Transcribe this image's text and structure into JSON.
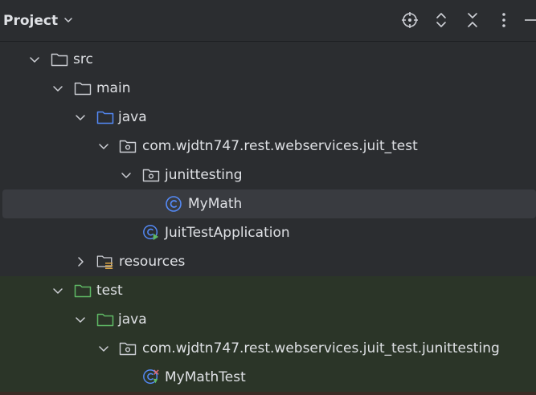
{
  "header": {
    "title": "Project",
    "icons": [
      "chevron-down-icon",
      "locate-icon",
      "expand-all-icon",
      "collapse-all-icon",
      "more-vert-icon",
      "minimize-icon"
    ]
  },
  "colors": {
    "background": "#2b2d30",
    "selected_row": "#393b40",
    "test_area": "#2b3528",
    "blue_folder": "#548af7",
    "green_folder": "#5fb865",
    "class_icon": "#548af7"
  },
  "tree": [
    {
      "label": "src",
      "expanded": true,
      "icon": "folder-icon"
    },
    {
      "label": "main",
      "expanded": true,
      "icon": "folder-icon"
    },
    {
      "label": "java",
      "expanded": true,
      "icon": "source-folder-icon"
    },
    {
      "label": "com.wjdtn747.rest.webservices.juit_test",
      "expanded": true,
      "icon": "package-icon"
    },
    {
      "label": "junittesting",
      "expanded": true,
      "icon": "package-icon"
    },
    {
      "label": "MyMath",
      "icon": "class-icon",
      "selected": true
    },
    {
      "label": "JuitTestApplication",
      "icon": "spring-boot-class-icon"
    },
    {
      "label": "resources",
      "expanded": false,
      "icon": "resources-folder-icon"
    },
    {
      "label": "test",
      "expanded": true,
      "icon": "test-folder-icon"
    },
    {
      "label": "java",
      "expanded": true,
      "icon": "test-source-folder-icon"
    },
    {
      "label": "com.wjdtn747.rest.webservices.juit_test.junittesting",
      "expanded": true,
      "icon": "package-icon"
    },
    {
      "label": "MyMathTest",
      "icon": "test-class-icon"
    }
  ]
}
